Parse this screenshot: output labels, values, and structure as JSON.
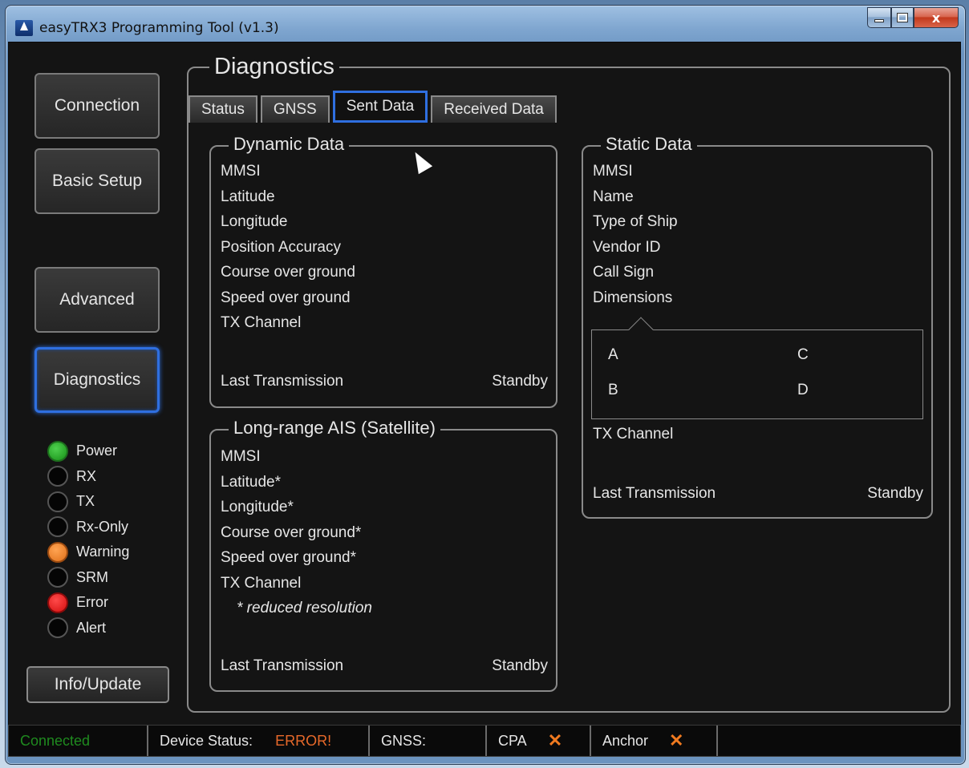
{
  "window": {
    "title": "easyTRX3 Programming Tool (v1.3)",
    "close_glyph": "x"
  },
  "nav": {
    "connection": "Connection",
    "basic_setup": "Basic Setup",
    "advanced": "Advanced",
    "diagnostics": "Diagnostics",
    "info_update": "Info/Update"
  },
  "leds": [
    {
      "label": "Power",
      "state": "green"
    },
    {
      "label": "RX",
      "state": "off"
    },
    {
      "label": "TX",
      "state": "off"
    },
    {
      "label": "Rx-Only",
      "state": "off"
    },
    {
      "label": "Warning",
      "state": "orange"
    },
    {
      "label": "SRM",
      "state": "off"
    },
    {
      "label": "Error",
      "state": "red"
    },
    {
      "label": "Alert",
      "state": "off"
    }
  ],
  "diagnostics": {
    "title": "Diagnostics",
    "tabs": [
      "Status",
      "GNSS",
      "Sent Data",
      "Received Data"
    ],
    "active_tab": "Sent Data"
  },
  "dynamic": {
    "title": "Dynamic Data",
    "fields": [
      "MMSI",
      "Latitude",
      "Longitude",
      "Position Accuracy",
      "Course over ground",
      "Speed over ground",
      "TX Channel"
    ],
    "last_tx_label": "Last Transmission",
    "last_tx_value": "Standby"
  },
  "satellite": {
    "title": "Long-range AIS (Satellite)",
    "fields": [
      "MMSI",
      "Latitude*",
      "Longitude*",
      "Course over ground*",
      "Speed over ground*",
      "TX Channel"
    ],
    "note": "* reduced resolution",
    "last_tx_label": "Last Transmission",
    "last_tx_value": "Standby"
  },
  "static": {
    "title": "Static Data",
    "fields": [
      "MMSI",
      "Name",
      "Type of Ship",
      "Vendor ID",
      "Call Sign",
      "Dimensions"
    ],
    "dims": {
      "a": "A",
      "b": "B",
      "c": "C",
      "d": "D"
    },
    "tx_channel": "TX Channel",
    "last_tx_label": "Last Transmission",
    "last_tx_value": "Standby"
  },
  "status_bar": {
    "connected": "Connected",
    "connected_color": "#1f8a1f",
    "device_status_label": "Device Status:",
    "device_status_value": "ERROR!",
    "error_color": "#e8692a",
    "gnss_label": "GNSS:",
    "cpa_label": "CPA",
    "anchor_label": "Anchor",
    "x_mark": "✕"
  }
}
